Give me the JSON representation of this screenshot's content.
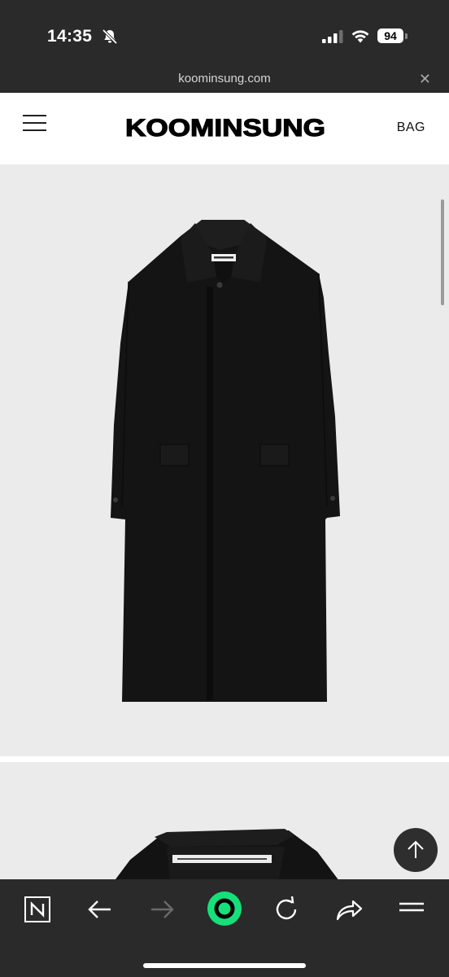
{
  "status_bar": {
    "time": "14:35",
    "battery_level": "94",
    "icons": [
      "bell-slash-icon",
      "cellular-signal-icon",
      "wifi-icon",
      "battery-icon"
    ]
  },
  "browser": {
    "url": "koominsung.com",
    "close_symbol": "✕"
  },
  "header": {
    "brand": "KOOMINSUNG",
    "bag_label": "BAG",
    "menu_icon": "hamburger-menu-icon"
  },
  "product": {
    "background_color": "#ebebeb",
    "garment_color": "#141414",
    "images": [
      "coat-front-view",
      "coat-collar-detail"
    ]
  },
  "toolbar": {
    "items": [
      "naver-n-icon",
      "back-arrow-icon",
      "forward-arrow-icon",
      "green-circle-home-icon",
      "refresh-icon",
      "share-icon",
      "menu-icon"
    ],
    "accent_color": "#16e07a"
  }
}
